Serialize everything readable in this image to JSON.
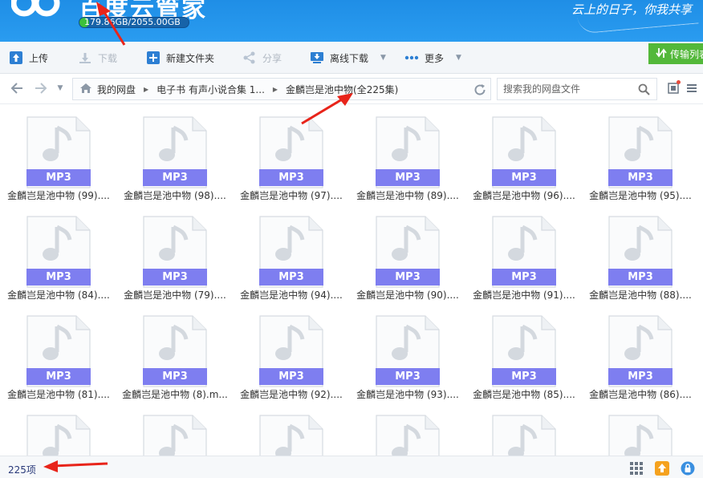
{
  "header": {
    "title": "百度云管家",
    "quota_text": "179.86GB/2055.00GB",
    "quota_fraction": 0.0875,
    "slogan": "云上的日子，你我共享"
  },
  "toolbar": {
    "upload": "上传",
    "download": "下载",
    "new_folder": "新建文件夹",
    "share": "分享",
    "offline_download": "离线下载",
    "more": "更多",
    "transfer_list": "传输列表"
  },
  "nav": {
    "breadcrumbs": [
      "我的网盘",
      "电子书 有声小说合集 1...",
      "金麟岂是池中物(全225集)"
    ],
    "search_placeholder": "搜索我的网盘文件"
  },
  "files": {
    "badge": "MP3",
    "items": [
      "金麟岂是池中物 (99)....",
      "金麟岂是池中物 (98)....",
      "金麟岂是池中物 (97)....",
      "金麟岂是池中物 (89)....",
      "金麟岂是池中物 (96)....",
      "金麟岂是池中物 (95)....",
      "金麟岂是池中物 (84)....",
      "金麟岂是池中物 (79)....",
      "金麟岂是池中物 (94)....",
      "金麟岂是池中物 (90)....",
      "金麟岂是池中物 (91)....",
      "金麟岂是池中物 (88)....",
      "金麟岂是池中物 (81)....",
      "金麟岂是池中物 (8).m...",
      "金麟岂是池中物 (92)....",
      "金麟岂是池中物 (93)....",
      "金麟岂是池中物 (85)....",
      "金麟岂是池中物 (86)....",
      "",
      "",
      "",
      "",
      "",
      ""
    ]
  },
  "status": {
    "count": "225项"
  },
  "colors": {
    "header_blue": "#2a9cf0",
    "badge_purple": "#7e7ef0",
    "quota_green": "#3cc13c",
    "transfer_green": "#53b83a",
    "arrow_red": "#e8241a"
  },
  "icons": [
    "upload-icon",
    "download-icon",
    "new-folder-icon",
    "share-icon",
    "offline-download-icon",
    "more-icon",
    "transfer-icon",
    "back-arrow-icon",
    "forward-arrow-icon",
    "home-icon",
    "refresh-icon",
    "search-icon",
    "music-note-icon",
    "grid-view-icon",
    "upload-arrow-icon",
    "lock-icon"
  ]
}
